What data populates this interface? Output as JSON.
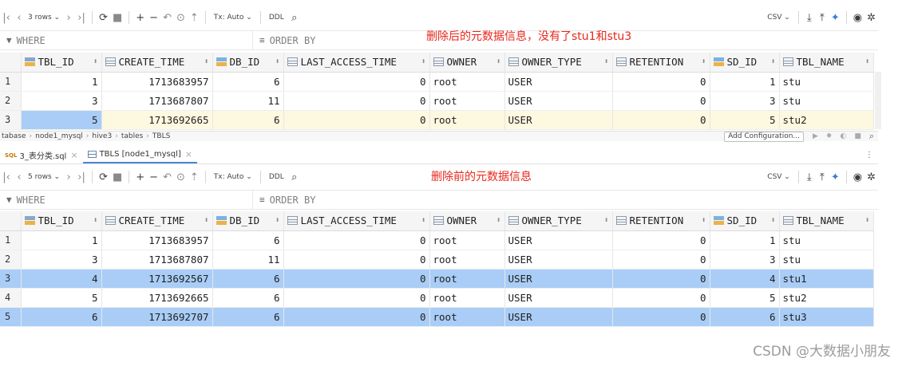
{
  "toolbar_top": {
    "rows_label": "3 rows",
    "tx_label": "Tx: Auto",
    "ddl_label": "DDL",
    "export_label": "CSV"
  },
  "toolbar_bottom": {
    "rows_label": "5 rows",
    "tx_label": "Tx: Auto",
    "ddl_label": "DDL",
    "export_label": "CSV"
  },
  "filters": {
    "where": "WHERE",
    "order_by": "ORDER BY"
  },
  "annotations": {
    "after": "删除后的元数据信息，没有了stu1和stu3",
    "before": "删除前的元数据信息"
  },
  "columns": [
    "TBL_ID",
    "CREATE_TIME",
    "DB_ID",
    "LAST_ACCESS_TIME",
    "OWNER",
    "OWNER_TYPE",
    "RETENTION",
    "SD_ID",
    "TBL_NAME"
  ],
  "table_after": [
    {
      "rn": "1",
      "cells": [
        "1",
        "1713683957",
        "6",
        "0",
        "root",
        "USER",
        "0",
        "1",
        "stu"
      ]
    },
    {
      "rn": "2",
      "cells": [
        "3",
        "1713687807",
        "11",
        "0",
        "root",
        "USER",
        "0",
        "3",
        "stu"
      ]
    },
    {
      "rn": "3",
      "cells": [
        "5",
        "1713692665",
        "6",
        "0",
        "root",
        "USER",
        "0",
        "5",
        "stu2"
      ]
    }
  ],
  "table_before": [
    {
      "rn": "1",
      "cells": [
        "1",
        "1713683957",
        "6",
        "0",
        "root",
        "USER",
        "0",
        "1",
        "stu"
      ]
    },
    {
      "rn": "2",
      "cells": [
        "3",
        "1713687807",
        "11",
        "0",
        "root",
        "USER",
        "0",
        "3",
        "stu"
      ]
    },
    {
      "rn": "3",
      "cells": [
        "4",
        "1713692567",
        "6",
        "0",
        "root",
        "USER",
        "0",
        "4",
        "stu1"
      ]
    },
    {
      "rn": "4",
      "cells": [
        "5",
        "1713692665",
        "6",
        "0",
        "root",
        "USER",
        "0",
        "5",
        "stu2"
      ]
    },
    {
      "rn": "5",
      "cells": [
        "6",
        "1713692707",
        "6",
        "0",
        "root",
        "USER",
        "0",
        "6",
        "stu3"
      ]
    }
  ],
  "breadcrumb": [
    "tabase",
    "node1_mysql",
    "hive3",
    "tables",
    "TBLS"
  ],
  "run_config_label": "Add Configuration...",
  "tabs": [
    {
      "label": "3_表分类.sql"
    },
    {
      "label": "TBLS [node1_mysql]"
    }
  ],
  "watermark": "CSDN @大数据小朋友"
}
